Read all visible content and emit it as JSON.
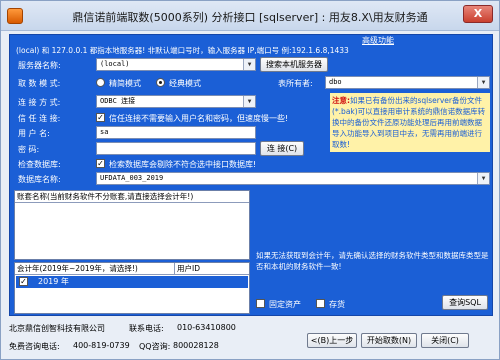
{
  "window": {
    "title": "鼎信诺前端取数(5000系列) 分析接口 [sqlserver] : 用友8.X\\用友财务通",
    "close_label": "X"
  },
  "connection": {
    "info_text": "(local) 和 127.0.0.1 都指本地服务器! 非默认端口号时，输入服务器 IP,端口号 例:192.1.6.8,1433",
    "advanced_link": "高级功能"
  },
  "form": {
    "server_label": "服务器名称:",
    "server_value": "(local)",
    "search_server_button": "搜索本机服务器",
    "mode_label": "取 数 模 式:",
    "mode_options": [
      "精简模式",
      "经典模式"
    ],
    "mode_selected": "经典模式",
    "owner_label": "表所有者:",
    "owner_value": "dbo",
    "conn_type_label": "连 接 方 式:",
    "conn_type_value": "ODBC 连接",
    "trust_label": "信 任 连 接:",
    "trust_checked": true,
    "trust_text": "信任连接不需要输入用户名和密码，但速度慢一些!",
    "user_label": "用    户    名:",
    "user_value": "sa",
    "password_label": "密          码:",
    "password_value": "",
    "connect_button": "连 接(C)",
    "check_db_label": "检查数据库:",
    "check_db_checked": true,
    "check_db_text": "检索数据库会剔除不符合选中接口数据库!",
    "db_name_label": "数据库名称:",
    "db_name_value": "UFDATA_003_2019"
  },
  "note": {
    "title": "注意:",
    "body": "如果已有备份出来的sqlserver备份文件(*.bak)可以直接用审计系统的鼎信诺数据库转换中的备份文件还原功能处理后再用前端数据导入功能导入到项目中去，无需再用前端进行取数!"
  },
  "accounts": {
    "header": "账套名称(当前财务软件不分账套,请直接选择会计年!)",
    "items": []
  },
  "years": {
    "header_year": "会计年(2019年~2019年，请选择!)",
    "header_user": "用户ID",
    "rows": [
      {
        "year": "2019 年",
        "checked": true
      }
    ]
  },
  "hint": {
    "text": "如果无法获取到会计年，请先确认选择的财务软件类型和数据库类型是否和本机的财务软件一致!"
  },
  "options": {
    "fixed_assets_label": "固定资产",
    "inventory_label": "存货",
    "query_sql_button": "查询SQL"
  },
  "footer": {
    "company": "北京鼎信创智科技有限公司",
    "phone_label": "联系电话:",
    "phone": "010-63410800",
    "hotline_label": "免费咨询电话:",
    "hotline": "400-819-0739",
    "qq_label": "QQ咨询:",
    "qq": "800028128",
    "prev_button": "<(B)上一步",
    "start_button": "开始取数(N)",
    "close_button": "关闭(C)"
  }
}
